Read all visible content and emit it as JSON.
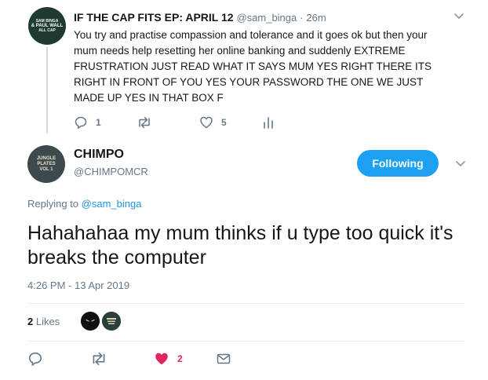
{
  "parent": {
    "author_name": "IF THE CAP FITS EP: APRIL 12",
    "handle": "@sam_binga",
    "separator": "·",
    "time": "26m",
    "avatar_text": [
      "SAM BINGA",
      "& PAUL WALL",
      "ALL CAP"
    ],
    "text": "You try and practise compassion and tolerance and it goes ok but then your mum needs help resetting her online banking and suddenly EXTREME FRUSTRATION JUST READ WHAT IT SAYS MUM YES RIGHT THERE ITS RIGHT IN FRONT OF YOU YES YOUR PASSWORD THE ONE WE JUST MADE UP YES IN THAT BOX F",
    "reply_count": "1",
    "like_count": "5"
  },
  "main": {
    "author_name": "CHIMPO",
    "handle": "@CHIMPOMCR",
    "avatar_text": [
      "JUNGLE PLATES",
      "VOL 1"
    ],
    "follow_label": "Following",
    "replying_prefix": "Replying to",
    "replying_handle": "@sam_binga",
    "text": "Hahahahaa my mum thinks if u type too quick it's breaks the computer",
    "timestamp": "4:26 PM - 13 Apr 2019",
    "likes_count": "2",
    "likes_label": "Likes",
    "heart_count": "2"
  },
  "colors": {
    "accent": "#1da1f2",
    "mention": "#1b95e0",
    "muted": "#657786",
    "liked": "#e0245e"
  }
}
